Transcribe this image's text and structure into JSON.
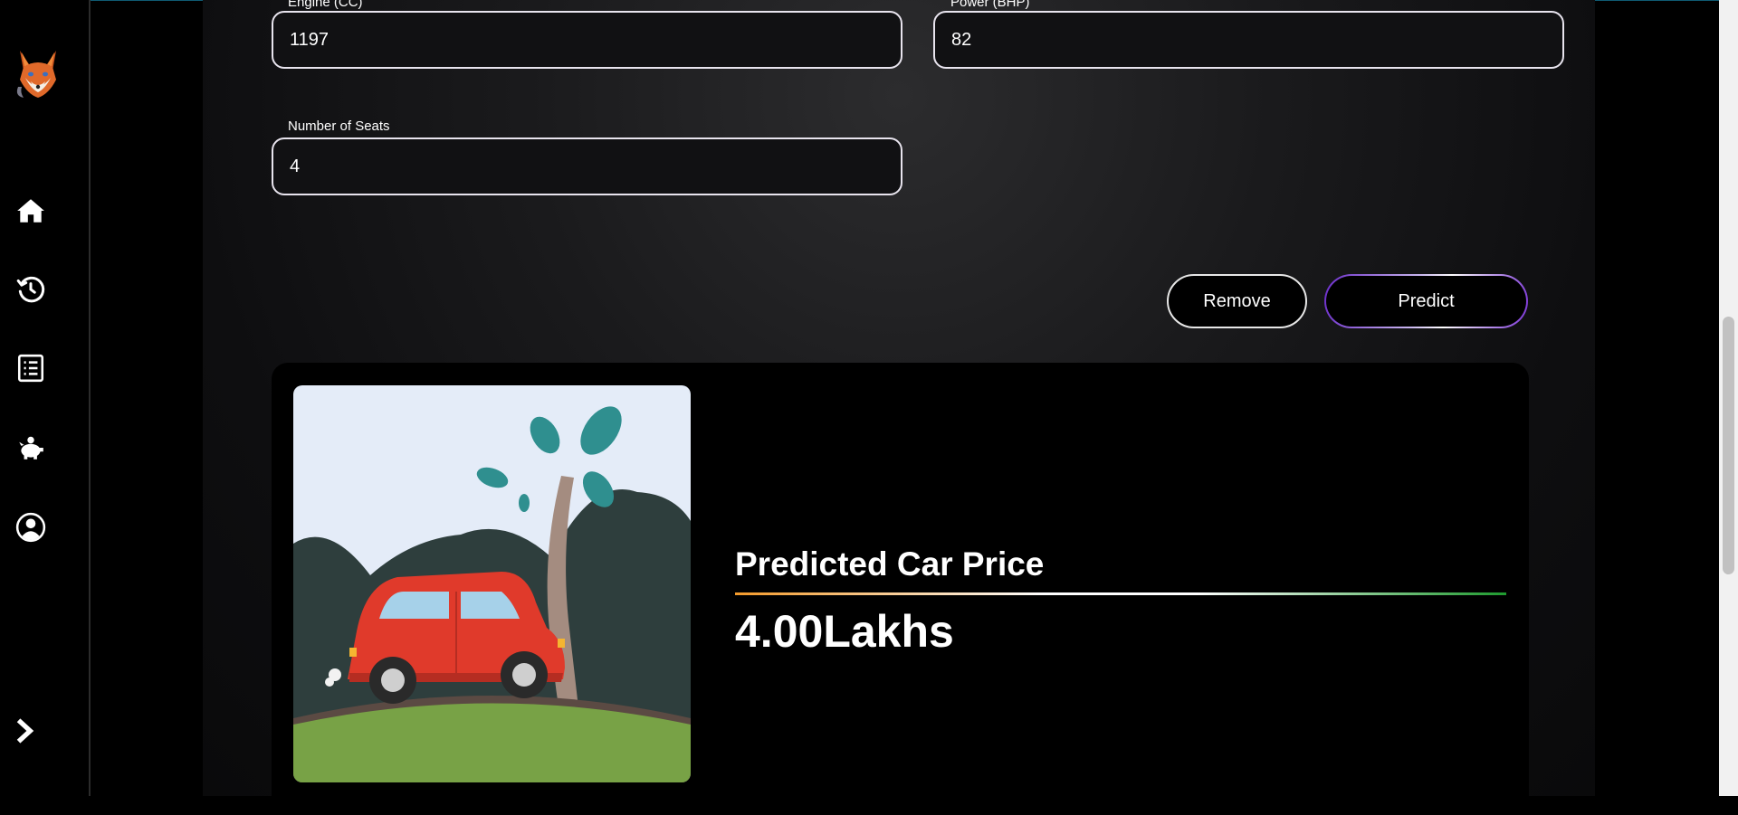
{
  "form": {
    "engine": {
      "label": "Engine (CC)",
      "value": "1197"
    },
    "power": {
      "label": "Power (BHP)",
      "value": "82"
    },
    "seats": {
      "label": "Number of Seats",
      "value": "4"
    }
  },
  "actions": {
    "remove_label": "Remove",
    "predict_label": "Predict"
  },
  "result": {
    "title": "Predicted Car Price",
    "value": "4.00Lakhs"
  },
  "sidebar": {
    "icons": [
      "fox-logo-icon",
      "home-icon",
      "history-icon",
      "list-icon",
      "piggy-bank-icon",
      "user-icon",
      "chevron-right-icon"
    ]
  },
  "colors": {
    "accent_purple": "#6a2cc9",
    "divider_orange": "#f39a2b",
    "divider_green": "#1f9a2f"
  }
}
